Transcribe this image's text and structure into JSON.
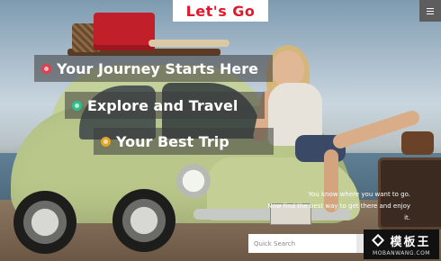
{
  "header": {
    "logo_text": "Let's Go",
    "menu_icon": "hamburger-menu-icon"
  },
  "hero": {
    "headlines": [
      {
        "text": "Your Journey Starts Here",
        "dot_color": "#e04050"
      },
      {
        "text": "Explore and Travel",
        "dot_color": "#2fbf8e"
      },
      {
        "text": "Your Best Trip",
        "dot_color": "#e0a52a"
      }
    ],
    "tagline_line1": "You know where you want to go.",
    "tagline_line2": "Now find the best way to get there and enjoy",
    "tagline_line3": "it."
  },
  "search": {
    "placeholder": "Quick Search"
  },
  "watermark": {
    "cn": "模板王",
    "en": "MOBANWANG.COM"
  },
  "colors": {
    "brand_red": "#e0182a",
    "menu_gray": "#5d5d5d"
  }
}
